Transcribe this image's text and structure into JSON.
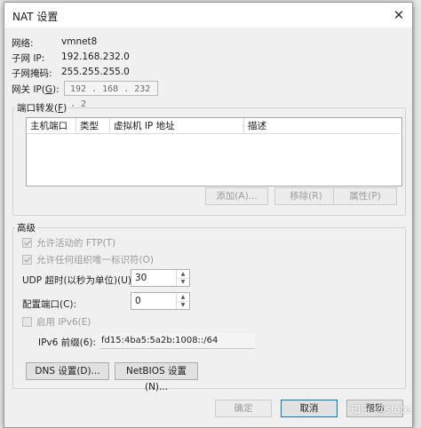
{
  "dialog": {
    "title": "NAT 设置",
    "close_glyph": "✕"
  },
  "info": {
    "network_label": "网络:",
    "network_value": "vmnet8",
    "subnet_ip_label": "子网 IP:",
    "subnet_ip_value": "192.168.232.0",
    "subnet_mask_label": "子网掩码:",
    "subnet_mask_value": "255.255.255.0",
    "gateway_label_pre": "网关 IP(",
    "gateway_label_key": "G",
    "gateway_label_post": "):",
    "gateway_value": "192 . 168 . 232 .  2"
  },
  "port_forwarding": {
    "legend_pre": "端口转发(",
    "legend_key": "F",
    "legend_post": ")",
    "columns": [
      "主机端口",
      "类型",
      "虚拟机 IP 地址",
      "描述"
    ],
    "add_button": "添加(A)...",
    "remove_button": "移除(R)",
    "properties_button": "属性(P)"
  },
  "advanced": {
    "legend": "高级",
    "allow_ftp": "允许活动的 FTP(T)",
    "allow_ftp_checked": true,
    "allow_oui": "允许任何组织唯一标识符(O)",
    "allow_oui_checked": true,
    "udp_timeout_label": "UDP 超时(以秒为单位)(U):",
    "udp_timeout_value": "30",
    "config_port_label": "配置端口(C):",
    "config_port_value": "0",
    "enable_ipv6": "启用 IPv6(E)",
    "enable_ipv6_checked": false,
    "ipv6_prefix_label": "IPv6 前缀(6):",
    "ipv6_prefix_value": "fd15:4ba5:5a2b:1008::/64",
    "dns_button": "DNS 设置(D)...",
    "netbios_button": "NetBIOS 设置(N)..."
  },
  "footer": {
    "ok_button": "确定",
    "cancel_button": "取消",
    "help_button": "帮助"
  },
  "watermark": "知乎 @slate",
  "colors": {
    "dialog_bg": "#f0f0f0",
    "accent": "#0078d7",
    "disabled_text": "#9b9b9b"
  }
}
